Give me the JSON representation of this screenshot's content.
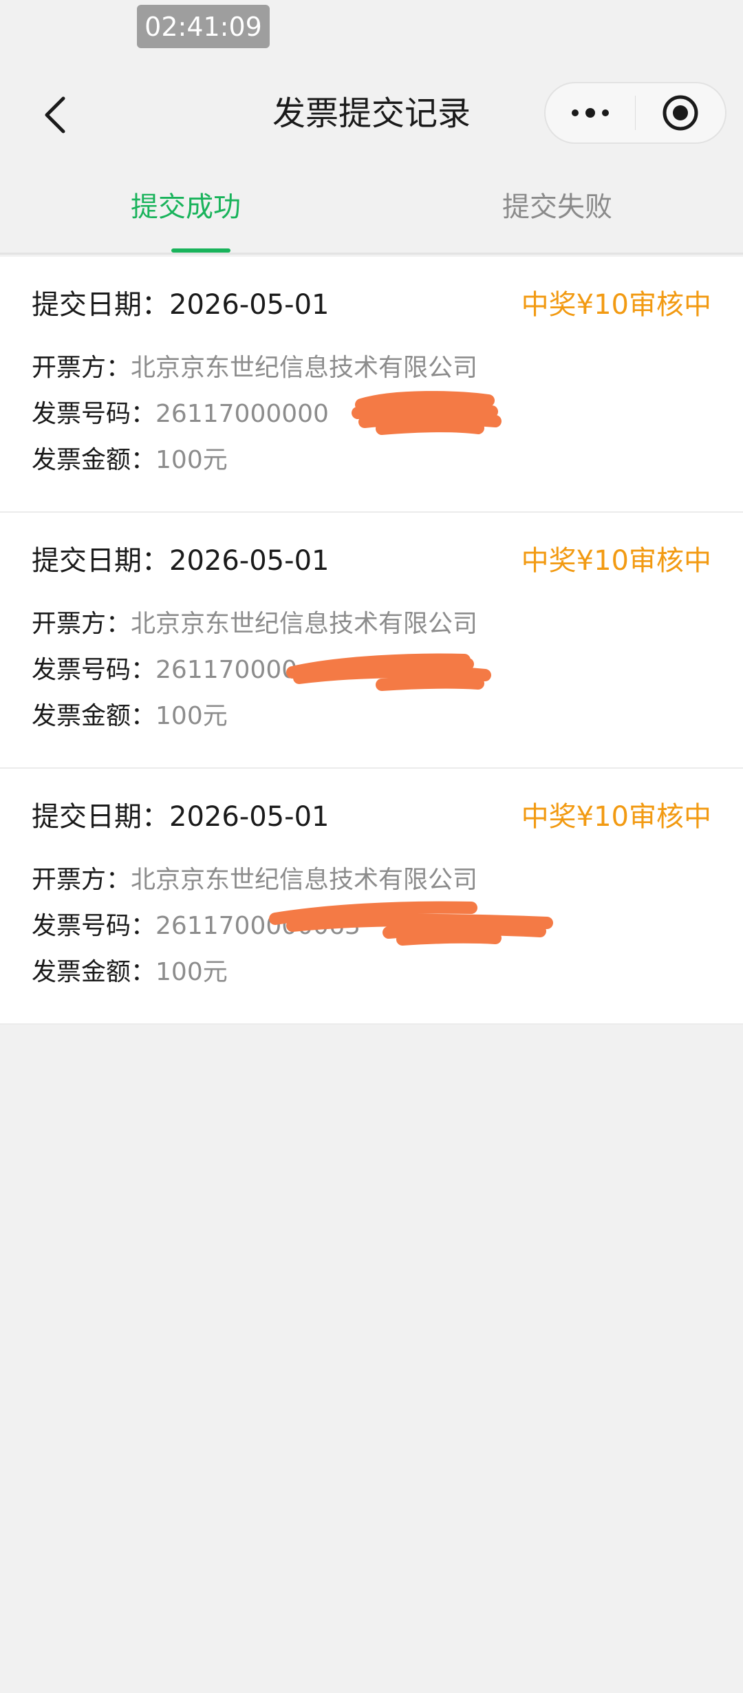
{
  "status": {
    "time": "02:41:09"
  },
  "nav": {
    "title": "发票提交记录",
    "more_icon": "more-dots-icon",
    "close_icon": "target-icon"
  },
  "tabs": [
    {
      "label": "提交成功",
      "active": true
    },
    {
      "label": "提交失败",
      "active": false
    }
  ],
  "labels": {
    "date": "提交日期：",
    "issuer": "开票方：",
    "number": "发票号码：",
    "amount": "发票金额："
  },
  "records": [
    {
      "date": "2026-05-01",
      "status": "中奖¥10审核中",
      "issuer": "北京京东世纪信息技术有限公司",
      "number_visible": "26117000000",
      "amount": "100元"
    },
    {
      "date": "2026-05-01",
      "status": "中奖¥10审核中",
      "issuer": "北京京东世纪信息技术有限公司",
      "number_visible": "261170000",
      "amount": "100元"
    },
    {
      "date": "2026-05-01",
      "status": "中奖¥10审核中",
      "issuer": "北京京东世纪信息技术有限公司",
      "number_visible": "2611700000063",
      "amount": "100元"
    }
  ],
  "colors": {
    "accent": "#19b35b",
    "status": "#f29a12",
    "redaction": "#f47a45"
  }
}
